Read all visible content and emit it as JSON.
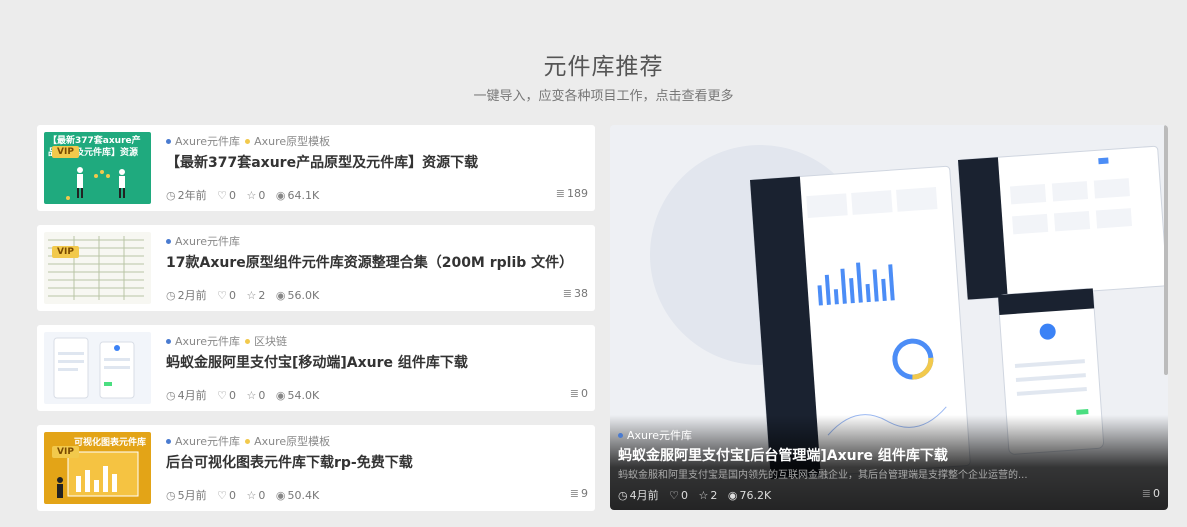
{
  "section": {
    "title": "元件库推荐",
    "subtitle": "一键导入，应变各种项目工作，点击查看更多"
  },
  "items": [
    {
      "categories": [
        "Axure元件库",
        "Axure原型模板"
      ],
      "title": "【最新377套axure产品原型及元件库】资源下载",
      "thumb_text": "【最新377套axure产品原型及元件库】资源",
      "vip": "VIP",
      "time": "2年前",
      "likes": "0",
      "favorites": "0",
      "views": "64.1K",
      "count": "189"
    },
    {
      "categories": [
        "Axure元件库"
      ],
      "title": "17款Axure原型组件元件库资源整理合集（200M rplib 文件）",
      "vip": "VIP",
      "time": "2月前",
      "likes": "0",
      "favorites": "2",
      "views": "56.0K",
      "count": "38"
    },
    {
      "categories": [
        "Axure元件库",
        "区块链"
      ],
      "title": "蚂蚁金服阿里支付宝[移动端]Axure 组件库下载",
      "time": "4月前",
      "likes": "0",
      "favorites": "0",
      "views": "54.0K",
      "count": "0"
    },
    {
      "categories": [
        "Axure元件库",
        "Axure原型模板"
      ],
      "title": "后台可视化图表元件库下载rp-免费下载",
      "thumb_text": "可视化图表元件库",
      "vip": "VIP",
      "time": "5月前",
      "likes": "0",
      "favorites": "0",
      "views": "50.4K",
      "count": "9"
    }
  ],
  "feature": {
    "category": "Axure元件库",
    "title": "蚂蚁金服阿里支付宝[后台管理端]Axure 组件库下载",
    "description": "蚂蚁金服和阿里支付宝是国内领先的互联网金融企业，其后台管理端是支撑整个企业运营的...",
    "time": "4月前",
    "likes": "0",
    "favorites": "2",
    "views": "76.2K",
    "count": "0"
  },
  "icons": {
    "clock": "clock-icon",
    "heart": "heart-icon",
    "star": "star-icon",
    "eye": "eye-icon",
    "stack": "stack-icon"
  }
}
